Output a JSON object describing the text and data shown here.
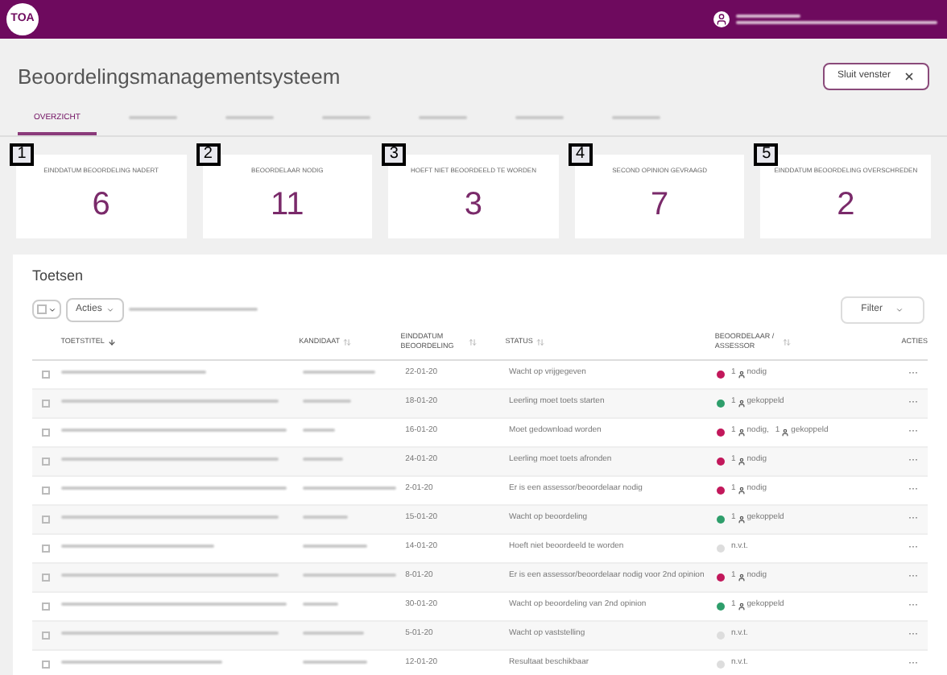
{
  "header": {
    "logo": "TOA"
  },
  "page": {
    "title": "Beoordelingsmanagementsysteem",
    "close_button": "Sluit venster"
  },
  "tabs": [
    {
      "label": "OVERZICHT",
      "selected": true
    },
    {
      "selected": false
    },
    {
      "selected": false
    },
    {
      "selected": false
    },
    {
      "selected": false
    },
    {
      "selected": false
    },
    {
      "selected": false
    }
  ],
  "cards": [
    {
      "badge": "1",
      "label": "EINDDATUM BEOORDELING NADERT",
      "value": "6"
    },
    {
      "badge": "2",
      "label": "BEOORDELAAR NODIG",
      "value": "11"
    },
    {
      "badge": "3",
      "label": "HOEFT NIET BEOORDEELD TE WORDEN",
      "value": "3"
    },
    {
      "badge": "4",
      "label": "SECOND OPINION GEVRAAGD",
      "value": "7"
    },
    {
      "badge": "5",
      "label": "EINDDATUM BEOORDELING OVERSCHREDEN",
      "value": "2"
    }
  ],
  "table": {
    "title": "Toetsen",
    "actions_button": "Acties",
    "filter_button": "Filter",
    "columns": [
      {
        "label": "TOETSTITEL",
        "sorted": true
      },
      {
        "label": "KANDIDAAT",
        "sorted": false
      },
      {
        "label": "EINDDATUM BEOORDELING",
        "sorted": false
      },
      {
        "label": "STATUS",
        "sorted": false
      },
      {
        "label": "BEOORDELAAR / ASSESSOR",
        "sorted": false
      },
      {
        "label": "ACTIES"
      }
    ],
    "rows": [
      {
        "checked": false,
        "date": "22-01-20",
        "status": "Wacht op vrijgegeven",
        "color": "#c2185b",
        "assessor": [
          {
            "count": "1",
            "label": "nodig"
          }
        ],
        "actions": "···"
      },
      {
        "checked": false,
        "date": "18-01-20",
        "status": "Leerling moet toets starten",
        "color": "#2e9e6b",
        "assessor": [
          {
            "count": "1",
            "label": "gekoppeld"
          }
        ],
        "actions": "···"
      },
      {
        "checked": false,
        "date": "16-01-20",
        "status": "Moet gedownload worden",
        "color": "#c2185b",
        "assessor": [
          {
            "count": "1",
            "label": "nodig,"
          },
          {
            "count": "1",
            "label": "gekoppeld"
          }
        ],
        "actions": "···"
      },
      {
        "checked": false,
        "date": "24-01-20",
        "status": "Leerling moet toets afronden",
        "color": "#c2185b",
        "assessor": [
          {
            "count": "1",
            "label": "nodig"
          }
        ],
        "actions": "···"
      },
      {
        "checked": false,
        "date": "2-01-20",
        "status": "Er is een assessor/beoordelaar nodig",
        "color": "#c2185b",
        "assessor": [
          {
            "count": "1",
            "label": "nodig"
          }
        ],
        "actions": "···"
      },
      {
        "checked": false,
        "date": "15-01-20",
        "status": "Wacht op beoordeling",
        "color": "#2e9e6b",
        "assessor": [
          {
            "count": "1",
            "label": "gekoppeld"
          }
        ],
        "actions": "···"
      },
      {
        "checked": false,
        "date": "14-01-20",
        "status": "Hoeft niet beoordeeld te worden",
        "color": "#dddddd",
        "na": "n.v.t.",
        "actions": "···"
      },
      {
        "checked": false,
        "date": "8-01-20",
        "status": "Er is een assessor/beoordelaar nodig voor 2nd opinion",
        "color": "#c2185b",
        "assessor": [
          {
            "count": "1",
            "label": "nodig"
          }
        ],
        "actions": "···"
      },
      {
        "checked": false,
        "date": "30-01-20",
        "status": "Wacht op beoordeling van 2nd opinion",
        "color": "#2e9e6b",
        "assessor": [
          {
            "count": "1",
            "label": "gekoppeld"
          }
        ],
        "actions": "···"
      },
      {
        "checked": false,
        "date": "5-01-20",
        "status": "Wacht op vaststelling",
        "color": "#dddddd",
        "na": "n.v.t.",
        "actions": "···"
      },
      {
        "checked": false,
        "date": "12-01-20",
        "status": "Resultaat beschikbaar",
        "color": "#dddddd",
        "na": "n.v.t.",
        "actions": "···"
      }
    ]
  }
}
